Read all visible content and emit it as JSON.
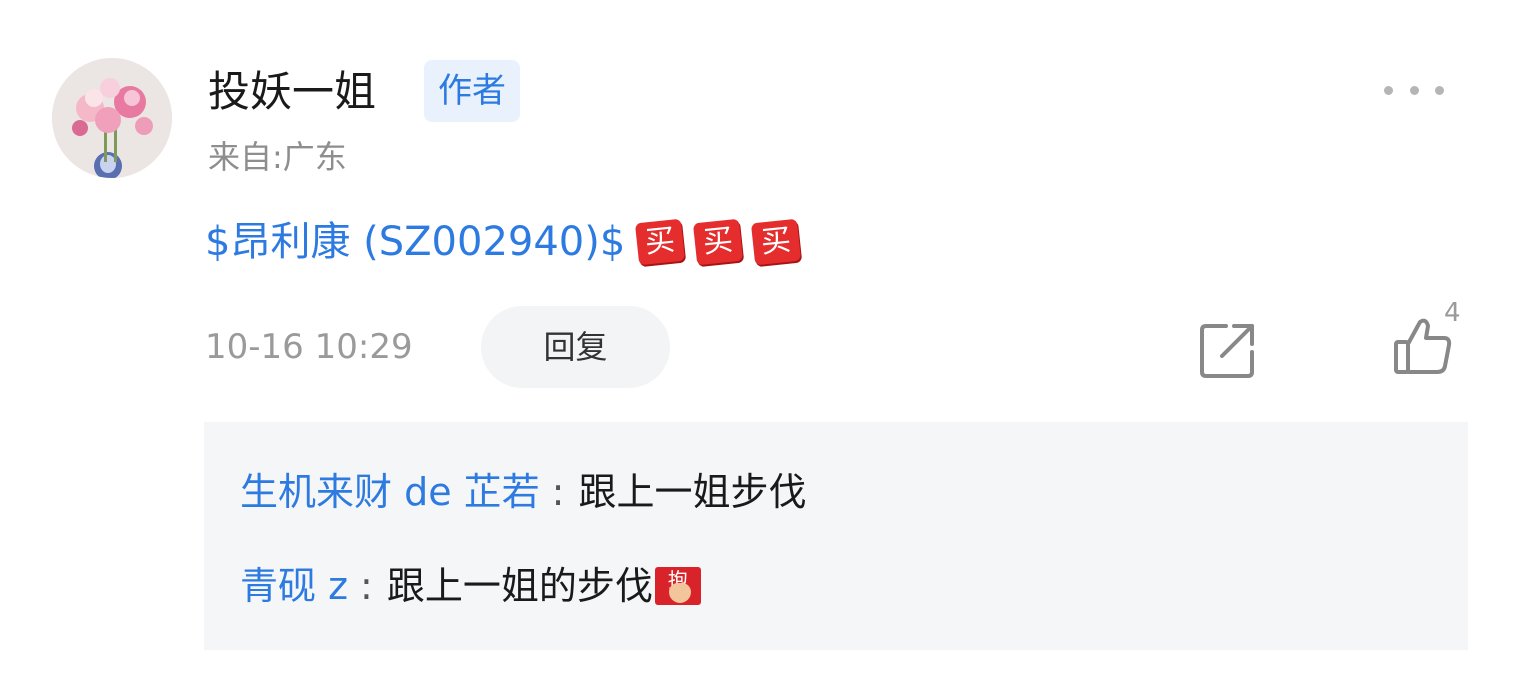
{
  "comment": {
    "username": "投妖一姐",
    "author_badge": "作者",
    "location": "来自:广东",
    "stock_link": "$昂利康 (SZ002940)$",
    "buy_emoji": [
      "买",
      "买",
      "买"
    ],
    "timestamp": "10-16 10:29",
    "reply_label": "回复",
    "like_count": "4",
    "colors": {
      "link_blue": "#2d7be0",
      "badge_bg": "#e8f1fc",
      "muted_gray": "#8e8e8e",
      "emoji_red": "#e52d2d"
    }
  },
  "replies": [
    {
      "user": "生机来财 de 芷若",
      "colon": ":",
      "text": "跟上一姐步伐",
      "emoji": ""
    },
    {
      "user": "青砚 z",
      "colon": ":",
      "text": "跟上一姐的步伐",
      "emoji": "fist-emoji"
    }
  ],
  "emoji_fist_text": "抱",
  "icons": {
    "more": "more-horizontal-icon",
    "share": "share-icon",
    "like": "thumbs-up-icon"
  }
}
